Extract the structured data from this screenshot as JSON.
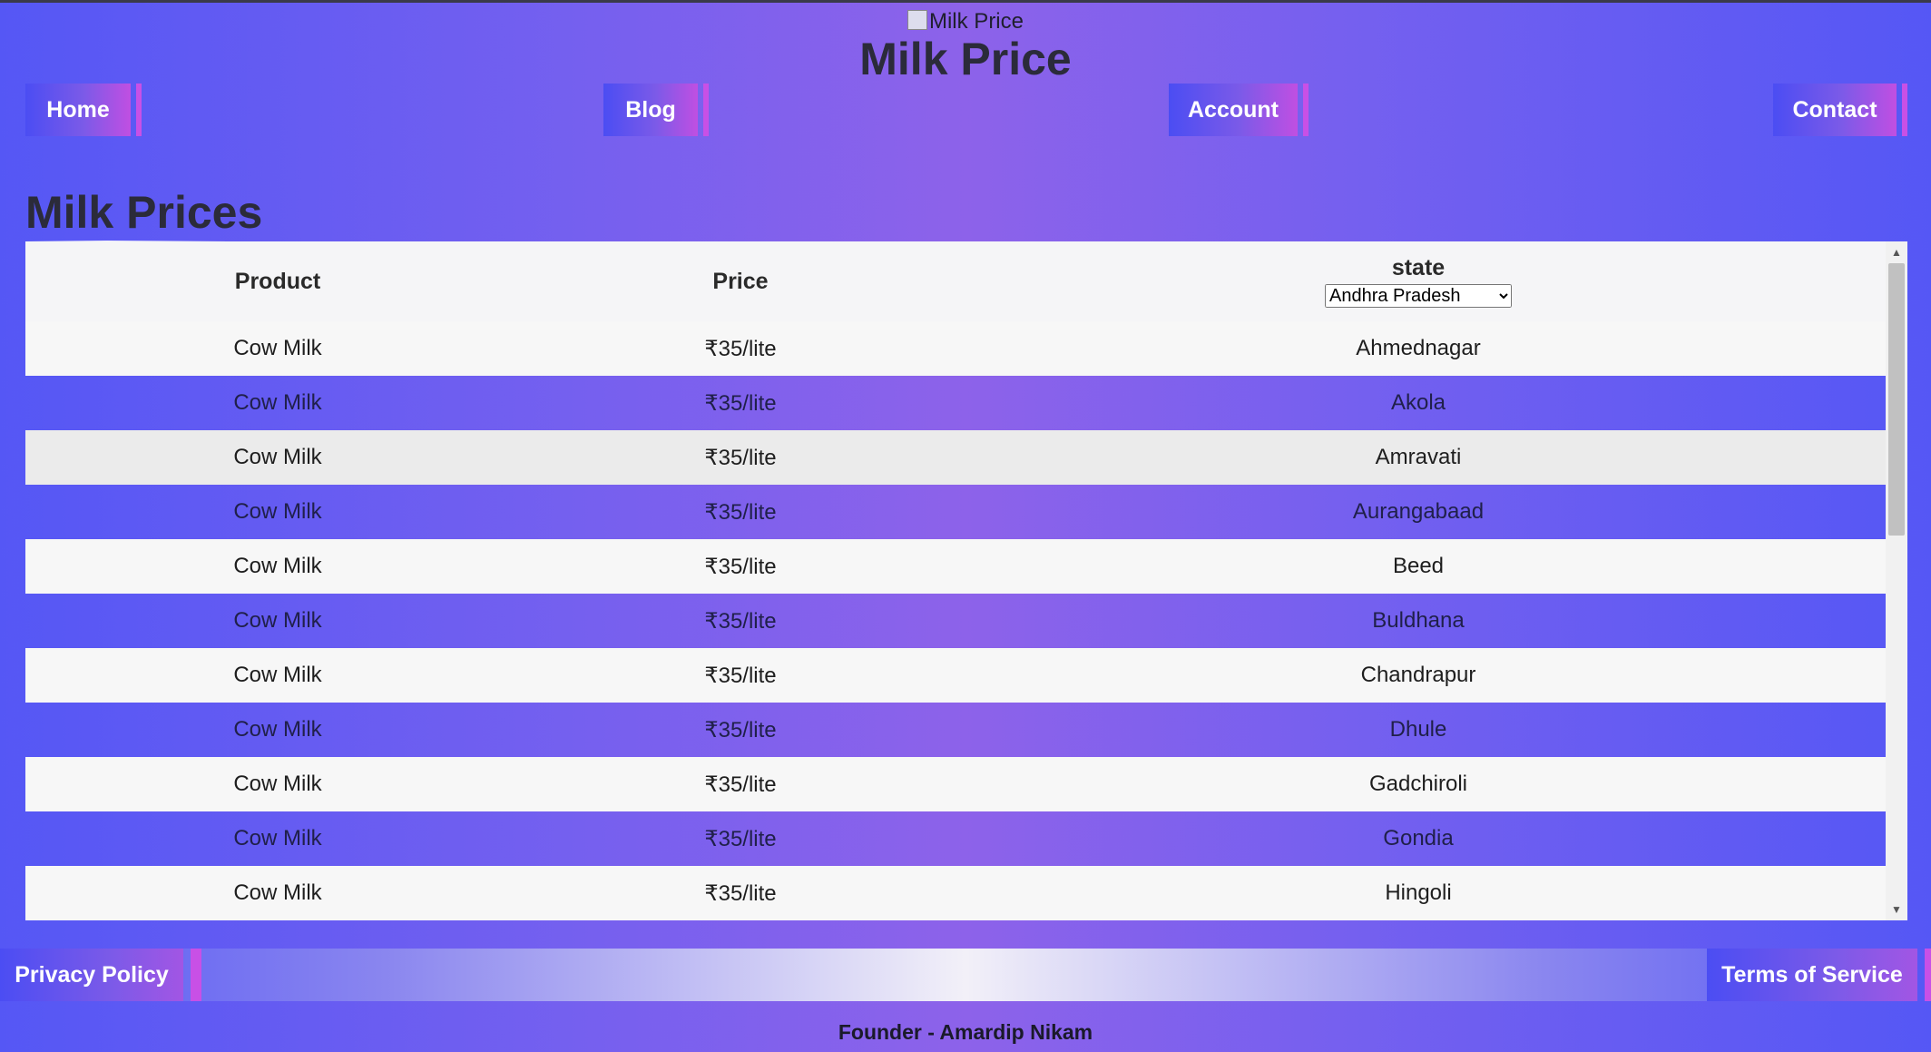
{
  "header": {
    "logo_alt": "Milk Price",
    "title": "Milk Price"
  },
  "nav": {
    "home": "Home",
    "blog": "Blog",
    "account": "Account",
    "contact": "Contact"
  },
  "main": {
    "section_title": "Milk Prices",
    "table": {
      "headers": {
        "product": "Product",
        "price": "Price",
        "state": "state"
      },
      "state_selected": "Andhra Pradesh",
      "rows": [
        {
          "product": "Cow Milk",
          "price": "₹35/lite",
          "district": "Ahmednagar"
        },
        {
          "product": "Cow Milk",
          "price": "₹35/lite",
          "district": "Akola"
        },
        {
          "product": "Cow Milk",
          "price": "₹35/lite",
          "district": "Amravati"
        },
        {
          "product": "Cow Milk",
          "price": "₹35/lite",
          "district": "Aurangabaad"
        },
        {
          "product": "Cow Milk",
          "price": "₹35/lite",
          "district": "Beed"
        },
        {
          "product": "Cow Milk",
          "price": "₹35/lite",
          "district": "Buldhana"
        },
        {
          "product": "Cow Milk",
          "price": "₹35/lite",
          "district": "Chandrapur"
        },
        {
          "product": "Cow Milk",
          "price": "₹35/lite",
          "district": "Dhule"
        },
        {
          "product": "Cow Milk",
          "price": "₹35/lite",
          "district": "Gadchiroli"
        },
        {
          "product": "Cow Milk",
          "price": "₹35/lite",
          "district": "Gondia"
        },
        {
          "product": "Cow Milk",
          "price": "₹35/lite",
          "district": "Hingoli"
        }
      ]
    }
  },
  "footer": {
    "privacy": "Privacy Policy",
    "terms": "Terms of Service",
    "founder": "Founder - Amardip Nikam"
  },
  "colors": {
    "background_start": "#5557f5",
    "background_mid": "#8d62ea",
    "accent_magenta": "#c850e6",
    "row_light": "#f7f7f7",
    "row_mid": "#ebebeb"
  }
}
